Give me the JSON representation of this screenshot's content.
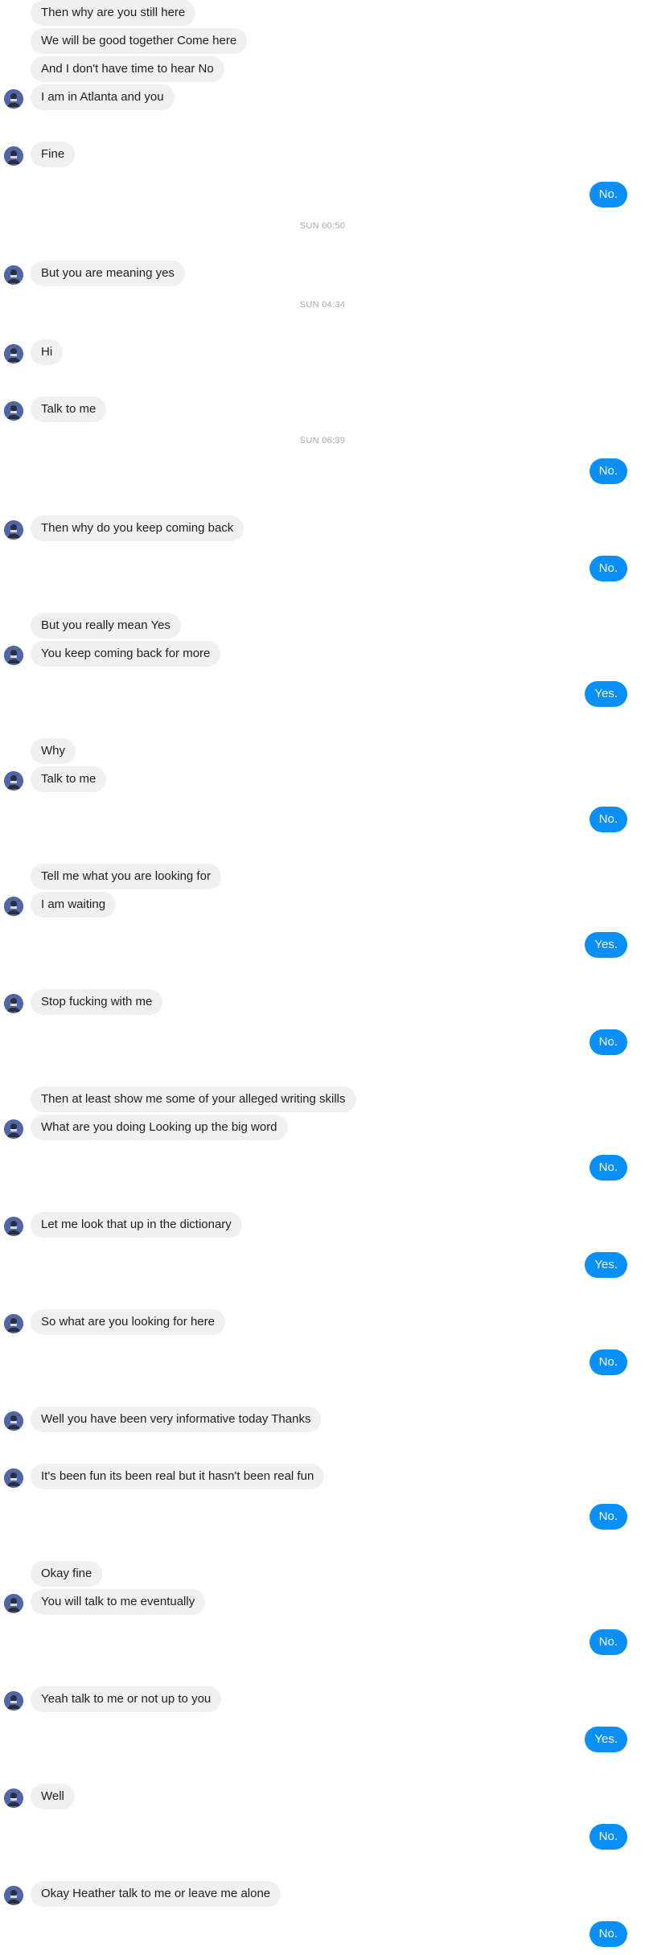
{
  "conversation": [
    {
      "type": "incoming",
      "text": "Then why are you still here"
    },
    {
      "type": "incoming",
      "text": "We will be good together Come here"
    },
    {
      "type": "incoming",
      "text": "And I don't have time to hear No"
    },
    {
      "type": "incoming",
      "text": "I am in Atlanta and you",
      "avatar": true
    },
    {
      "type": "incoming",
      "text": "Fine",
      "avatar": true
    },
    {
      "type": "outgoing",
      "text": "No."
    },
    {
      "type": "timestamp",
      "text": "SUN 00:50"
    },
    {
      "type": "incoming",
      "text": "But you are meaning yes",
      "avatar": true
    },
    {
      "type": "timestamp",
      "text": "SUN 04:34"
    },
    {
      "type": "incoming",
      "text": "Hi",
      "avatar": true
    },
    {
      "type": "incoming",
      "text": "Talk to me",
      "avatar": true
    },
    {
      "type": "timestamp",
      "text": "SUN 06:39"
    },
    {
      "type": "outgoing",
      "text": "No."
    },
    {
      "type": "incoming",
      "text": "Then why do you keep coming back",
      "avatar": true
    },
    {
      "type": "outgoing",
      "text": "No."
    },
    {
      "type": "incoming",
      "text": "But you really mean Yes"
    },
    {
      "type": "incoming",
      "text": "You keep coming back for more",
      "avatar": true
    },
    {
      "type": "outgoing",
      "text": "Yes."
    },
    {
      "type": "incoming",
      "text": "Why"
    },
    {
      "type": "incoming",
      "text": "Talk to me",
      "avatar": true
    },
    {
      "type": "outgoing",
      "text": "No."
    },
    {
      "type": "incoming",
      "text": "Tell me what you are looking for"
    },
    {
      "type": "incoming",
      "text": "I am waiting",
      "avatar": true
    },
    {
      "type": "outgoing",
      "text": "Yes."
    },
    {
      "type": "incoming",
      "text": "Stop fucking with me",
      "avatar": true
    },
    {
      "type": "outgoing",
      "text": "No."
    },
    {
      "type": "incoming",
      "text": "Then at least show me some of your alleged writing skills"
    },
    {
      "type": "incoming",
      "text": "What are you doing Looking up the big word",
      "avatar": true
    },
    {
      "type": "outgoing",
      "text": "No."
    },
    {
      "type": "incoming",
      "text": "Let me look that up in the dictionary",
      "avatar": true
    },
    {
      "type": "outgoing",
      "text": "Yes."
    },
    {
      "type": "incoming",
      "text": "So what are you looking for here",
      "avatar": true
    },
    {
      "type": "outgoing",
      "text": "No."
    },
    {
      "type": "incoming",
      "text": "Well you have been very informative today Thanks",
      "avatar": true
    },
    {
      "type": "incoming",
      "text": "It's been fun its been real but it hasn't been real fun",
      "avatar": true
    },
    {
      "type": "outgoing",
      "text": "No."
    },
    {
      "type": "incoming",
      "text": "Okay fine"
    },
    {
      "type": "incoming",
      "text": "You will talk to me eventually",
      "avatar": true
    },
    {
      "type": "outgoing",
      "text": "No."
    },
    {
      "type": "incoming",
      "text": "Yeah talk to me or not up to you",
      "avatar": true
    },
    {
      "type": "outgoing",
      "text": "Yes."
    },
    {
      "type": "incoming",
      "text": "Well",
      "avatar": true
    },
    {
      "type": "outgoing",
      "text": "No."
    },
    {
      "type": "incoming",
      "text": "Okay Heather talk to me or leave me alone",
      "avatar": true
    },
    {
      "type": "outgoing",
      "text": "No."
    }
  ],
  "colors": {
    "incoming_bubble": "#f1f0f0",
    "outgoing_bubble": "#0a8ff7",
    "timestamp_text": "#a7a9ac"
  }
}
